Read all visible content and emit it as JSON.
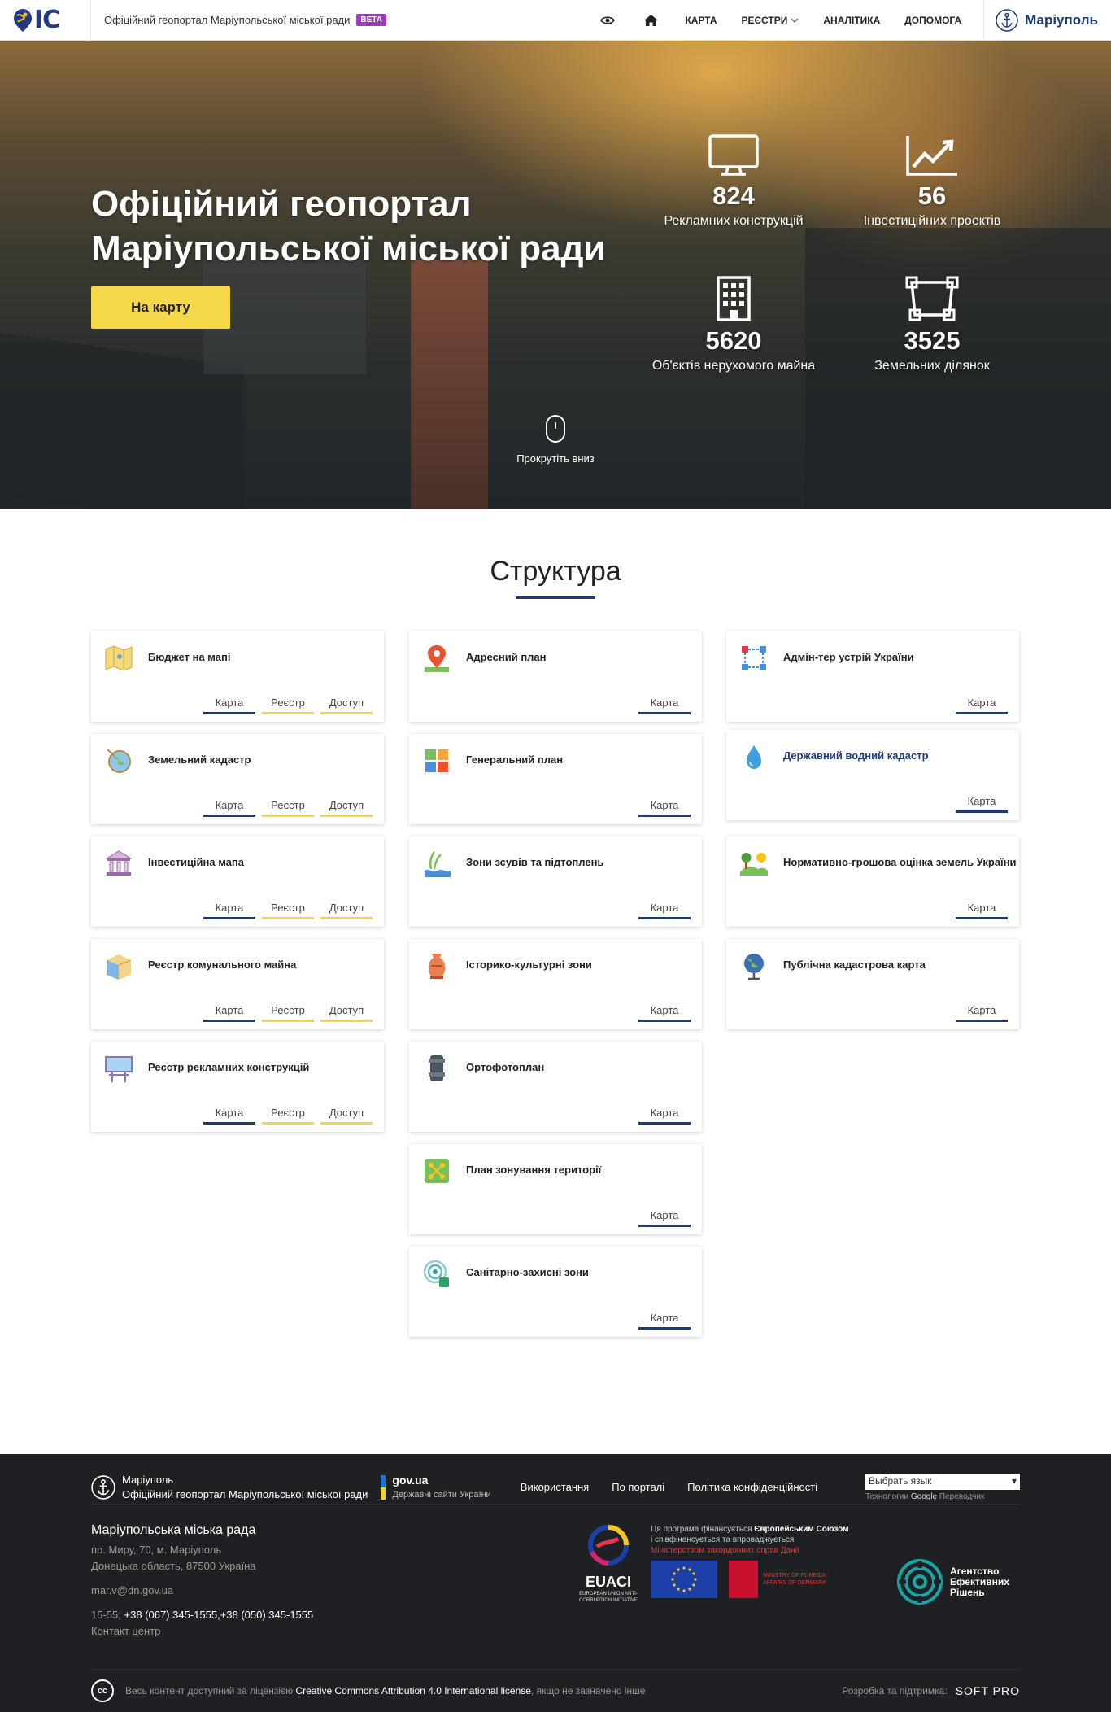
{
  "header": {
    "logo_text": "IC",
    "site_title": "Офіційний геопортал Маріупольської міської ради",
    "beta": "BETA",
    "nav": {
      "map": "КАРТА",
      "registries": "РЕЄСТРИ",
      "analytics": "АНАЛІТИКА",
      "help": "ДОПОМОГА"
    },
    "city": "Маріуполь"
  },
  "hero": {
    "title_line1": "Офіційний геопортал",
    "title_line2": "Маріупольської міської ради",
    "button": "На карту",
    "scroll": "Прокрутіть вниз",
    "stats": [
      {
        "icon": "monitor-icon",
        "value": "824",
        "label": "Рекламних конструкцій"
      },
      {
        "icon": "chart-line-icon",
        "value": "56",
        "label": "Інвестиційних проектів"
      },
      {
        "icon": "building-icon",
        "value": "5620",
        "label": "Об'єктів нерухомого майна"
      },
      {
        "icon": "land-parcel-icon",
        "value": "3525",
        "label": "Земельних ділянок"
      }
    ]
  },
  "structure": {
    "title": "Структура",
    "link_labels": {
      "map": "Карта",
      "registry": "Реєстр",
      "access": "Доступ"
    },
    "col1": [
      {
        "title": "Бюджет на мапі",
        "icon": "map-icon"
      },
      {
        "title": "Земельний кадастр",
        "icon": "globe-compass-icon"
      },
      {
        "title": "Інвестиційна мапа",
        "icon": "bank-icon"
      },
      {
        "title": "Реєстр комунального майна",
        "icon": "room-icon"
      },
      {
        "title": "Реєстр рекламних конструкцій",
        "icon": "billboard-icon"
      }
    ],
    "col2": [
      {
        "title": "Адресний план",
        "icon": "location-pin-icon"
      },
      {
        "title": "Генеральний план",
        "icon": "city-plan-icon"
      },
      {
        "title": "Зони зсувів та підтоплень",
        "icon": "water-plant-icon"
      },
      {
        "title": "Історико-культурні зони",
        "icon": "vase-icon"
      },
      {
        "title": "Ортофотоплан",
        "icon": "camera-lens-icon"
      },
      {
        "title": "План зонування території",
        "icon": "zoning-icon"
      },
      {
        "title": "Санітарно-захисні зони",
        "icon": "radar-icon"
      }
    ],
    "col3": [
      {
        "title": "Адмін-тер устрій України",
        "icon": "network-icon"
      },
      {
        "title": "Державний водний кадастр",
        "icon": "water-drop-icon"
      },
      {
        "title": "Нормативно-грошова оцінка земель України",
        "icon": "landscape-icon"
      },
      {
        "title": "Публічна кадастрова карта",
        "icon": "globe-icon"
      }
    ]
  },
  "footer": {
    "city": "Маріуполь",
    "portal": "Офіційний геопортал Маріупольської міської ради",
    "gov_title": "gov.ua",
    "gov_sub": "Державні сайти України",
    "links": [
      "Використання",
      "По порталі",
      "Політика конфіденційності"
    ],
    "lang_select": "Выбрать язык",
    "lang_note_prefix": "Технологии",
    "lang_note_google": "Google",
    "lang_note_suffix": "Переводчик",
    "org": "Маріупольська міська рада",
    "address1": "пр. Миру, 70, м. Маріуполь",
    "address2": "Донецька область, 87500 Україна",
    "email": "mar.v@dn.gov.ua",
    "hours": "15-55;",
    "phones": "+38 (067) 345-1555,+38 (050) 345-1555",
    "contact_center": "Контакт центр",
    "euaci": "EUACI",
    "euaci_sub": "EUROPEAN UNION ANTI-CORRUPTION INITIATIVE",
    "eu_text1": "Ця програма фінансується",
    "eu_text1_bold": "Європейським Союзом",
    "eu_text2": "і співфінансується та впроваджується",
    "eu_text3": "Міністерством закордонних справ Данії",
    "dk_text": "MINISTRY OF FOREIGN AFFAIRS OF DENMARK",
    "aer": [
      "Агентство",
      "Ефективних",
      "Рішень"
    ],
    "license_pre": "Весь контент доступний за ліцензією",
    "license": "Creative Commons Attribution 4.0 International license",
    "license_post": ", якщо не зазначено інше",
    "dev_label": "Розробка та підтримка:",
    "dev": "SOFT PRO"
  },
  "colors": {
    "brand_blue": "#1d3a7d",
    "accent_yellow": "#f6d94b",
    "beta_purple": "#9c3bbd",
    "footer_bg": "#1f2023"
  }
}
